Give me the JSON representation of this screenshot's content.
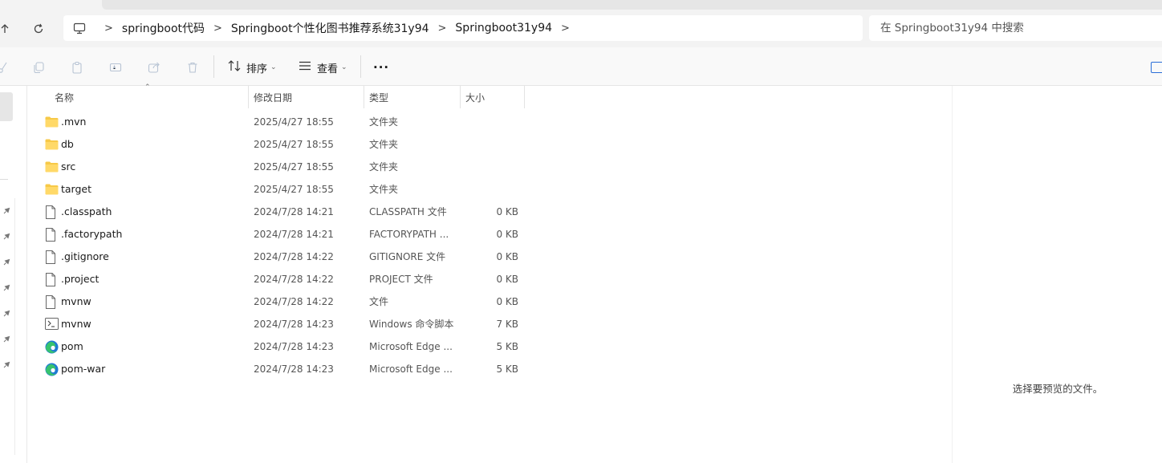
{
  "address_bar": {
    "crumbs": [
      "springboot代码",
      "Springboot个性化图书推荐系统31y94",
      "Springboot31y94"
    ]
  },
  "search": {
    "placeholder": "在 Springboot31y94 中搜索"
  },
  "toolbar": {
    "sort_label": "排序",
    "view_label": "查看",
    "more_label": "···"
  },
  "columns": {
    "name": "名称",
    "modified": "修改日期",
    "type": "类型",
    "size": "大小"
  },
  "files": [
    {
      "name": ".mvn",
      "modified": "2025/4/27 18:55",
      "type": "文件夹",
      "size": "",
      "icon": "folder-icon"
    },
    {
      "name": "db",
      "modified": "2025/4/27 18:55",
      "type": "文件夹",
      "size": "",
      "icon": "folder-icon"
    },
    {
      "name": "src",
      "modified": "2025/4/27 18:55",
      "type": "文件夹",
      "size": "",
      "icon": "folder-icon"
    },
    {
      "name": "target",
      "modified": "2025/4/27 18:55",
      "type": "文件夹",
      "size": "",
      "icon": "folder-icon"
    },
    {
      "name": ".classpath",
      "modified": "2024/7/28 14:21",
      "type": "CLASSPATH 文件",
      "size": "0 KB",
      "icon": "file-icon"
    },
    {
      "name": ".factorypath",
      "modified": "2024/7/28 14:21",
      "type": "FACTORYPATH ...",
      "size": "0 KB",
      "icon": "file-icon"
    },
    {
      "name": ".gitignore",
      "modified": "2024/7/28 14:22",
      "type": "GITIGNORE 文件",
      "size": "0 KB",
      "icon": "file-icon"
    },
    {
      "name": ".project",
      "modified": "2024/7/28 14:22",
      "type": "PROJECT 文件",
      "size": "0 KB",
      "icon": "file-icon"
    },
    {
      "name": "mvnw",
      "modified": "2024/7/28 14:22",
      "type": "文件",
      "size": "0 KB",
      "icon": "file-icon"
    },
    {
      "name": "mvnw",
      "modified": "2024/7/28 14:23",
      "type": "Windows 命令脚本",
      "size": "7 KB",
      "icon": "script-file-icon"
    },
    {
      "name": "pom",
      "modified": "2024/7/28 14:23",
      "type": "Microsoft Edge ...",
      "size": "5 KB",
      "icon": "edge-icon"
    },
    {
      "name": "pom-war",
      "modified": "2024/7/28 14:23",
      "type": "Microsoft Edge ...",
      "size": "5 KB",
      "icon": "edge-icon"
    }
  ],
  "preview": {
    "message": "选择要预览的文件。"
  },
  "colors": {
    "folder": "#f7c948",
    "edge_blue": "#1f7ad3",
    "edge_green": "#37c36e",
    "accent": "#2a6ed8"
  }
}
